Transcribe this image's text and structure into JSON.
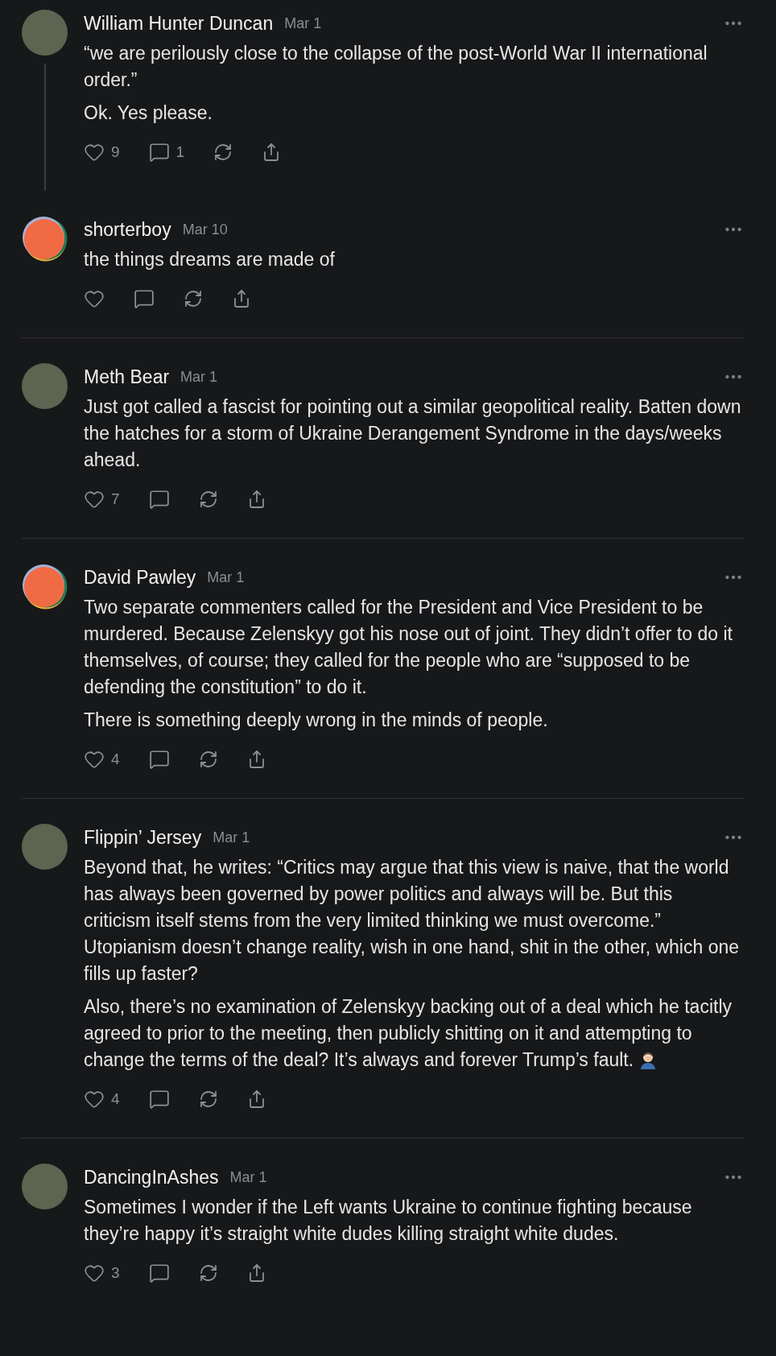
{
  "threads": [
    {
      "author": "William Hunter Duncan",
      "date": "Mar 1",
      "avatar": {
        "kind": "photo"
      },
      "paragraphs": [
        {
          "text": "“we are perilously close to the collapse of the post-World War II international order.”"
        },
        {
          "text": "Ok. Yes please."
        }
      ],
      "likes": "9",
      "comments": "1",
      "replies": [
        {
          "author": "shorterboy",
          "date": "Mar 10",
          "avatar": {
            "kind": "default"
          },
          "paragraphs": [
            {
              "text": "the things dreams are made of"
            }
          ]
        }
      ]
    },
    {
      "author": "Meth Bear",
      "date": "Mar 1",
      "avatar": {
        "kind": "photo"
      },
      "paragraphs": [
        {
          "text": "Just got called a fascist for pointing out a similar geopolitical reality. Batten down the hatches for a storm of Ukraine Derangement Syndrome in the days/weeks ahead."
        }
      ],
      "likes": "7"
    },
    {
      "author": "David Pawley",
      "date": "Mar 1",
      "avatar": {
        "kind": "default"
      },
      "paragraphs": [
        {
          "text": "Two separate commenters called for the President and Vice President to be murdered. Because Zelenskyy got his nose out of joint. They didn’t offer to do it themselves, of course; they called for the people who are “supposed to be defending the constitution” to do it."
        },
        {
          "text": "There is something deeply wrong in the minds of people."
        }
      ],
      "likes": "4"
    },
    {
      "author": "Flippin’ Jersey",
      "date": "Mar 1",
      "avatar": {
        "kind": "photo"
      },
      "paragraphs": [
        {
          "text": "Beyond that, he writes: “Critics may argue that this view is naive, that the world has always been governed by power politics and always will be. But this criticism itself stems from the very limited thinking we must overcome.” Utopianism doesn’t change reality, wish in one hand, shit in the other, which one fills up faster?"
        },
        {
          "text": "Also, there’s no examination of Zelenskyy backing out of a deal which he tacitly agreed to prior to the meeting, then publicly shitting on it and attempting to change the terms of the deal? It’s always and forever Trump’s fault.",
          "emoji": true
        }
      ],
      "likes": "4"
    },
    {
      "author": "DancingInAshes",
      "date": "Mar 1",
      "avatar": {
        "kind": "photo"
      },
      "paragraphs": [
        {
          "text": "Sometimes I wonder if the Left wants Ukraine to continue fighting because they’re happy it’s straight white dudes killing straight white dudes."
        }
      ],
      "likes": "3"
    }
  ]
}
